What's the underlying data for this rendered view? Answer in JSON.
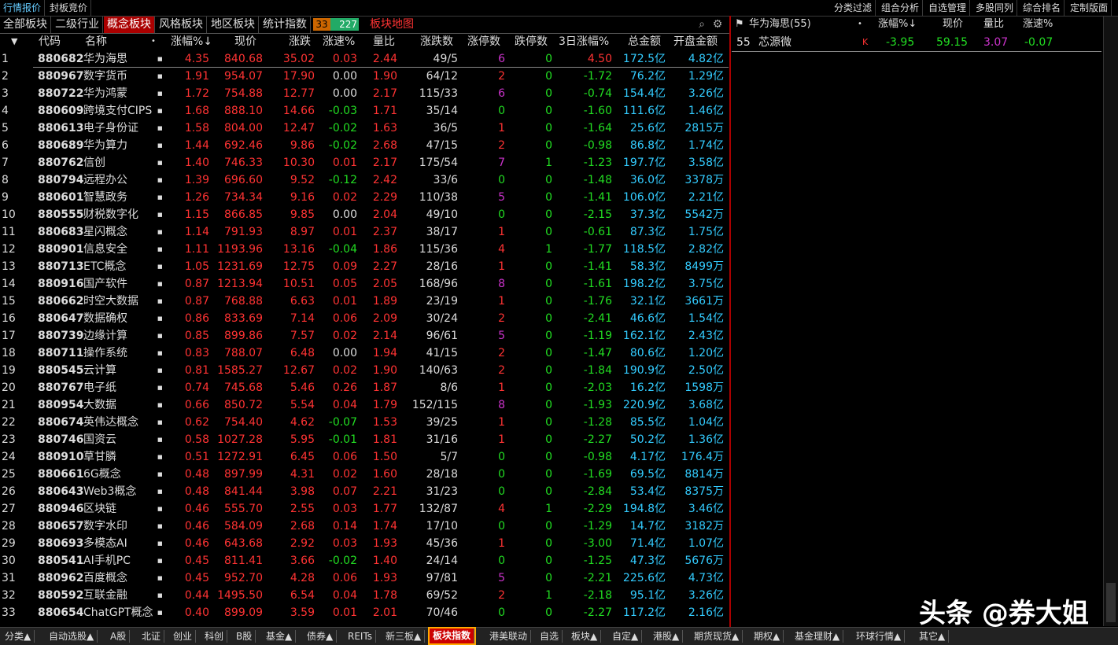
{
  "topbar": {
    "left": [
      "行情报价",
      "封板竞价"
    ],
    "right": [
      "分类过滤",
      "组合分析",
      "自选管理",
      "多股同列",
      "综合排名",
      "定制版面"
    ]
  },
  "cattabs": [
    "全部板块",
    "二级行业",
    "概念板块",
    "风格板块",
    "地区板块",
    "统计指数"
  ],
  "counter": {
    "a": "33",
    "b": "227"
  },
  "map_tab": "板块地图",
  "headers": {
    "idx": "▼",
    "code": "代码",
    "name": "名称",
    "dot": "•",
    "pct": "涨幅%↓",
    "price": "现价",
    "chg": "涨跌",
    "speed": "涨速%",
    "vr": "量比",
    "updown": "涨跌数",
    "zt": "涨停数",
    "dt": "跌停数",
    "d3": "3日涨幅%",
    "amt": "总金额",
    "open": "开盘金额"
  },
  "rows": [
    {
      "i": "1",
      "code": "880682",
      "name": "华为海思",
      "pct": "4.35",
      "price": "840.68",
      "chg": "35.02",
      "speed": "0.03",
      "vr": "2.44",
      "ud": "49/5",
      "zt": "6",
      "dt": "0",
      "d3": "4.50",
      "amt": "172.5亿",
      "open": "4.82亿"
    },
    {
      "i": "2",
      "code": "880967",
      "name": "数字货币",
      "pct": "1.91",
      "price": "954.07",
      "chg": "17.90",
      "speed": "0.00",
      "vr": "1.90",
      "ud": "64/12",
      "zt": "2",
      "dt": "0",
      "d3": "-1.72",
      "amt": "76.2亿",
      "open": "1.29亿"
    },
    {
      "i": "3",
      "code": "880722",
      "name": "华为鸿蒙",
      "pct": "1.72",
      "price": "754.88",
      "chg": "12.77",
      "speed": "0.00",
      "vr": "2.17",
      "ud": "115/33",
      "zt": "6",
      "dt": "0",
      "d3": "-0.74",
      "amt": "154.4亿",
      "open": "3.26亿"
    },
    {
      "i": "4",
      "code": "880609",
      "name": "跨境支付CIPS",
      "pct": "1.68",
      "price": "888.10",
      "chg": "14.66",
      "speed": "-0.03",
      "vr": "1.71",
      "ud": "35/14",
      "zt": "0",
      "dt": "0",
      "d3": "-1.60",
      "amt": "111.6亿",
      "open": "1.46亿"
    },
    {
      "i": "5",
      "code": "880613",
      "name": "电子身份证",
      "pct": "1.58",
      "price": "804.00",
      "chg": "12.47",
      "speed": "-0.02",
      "vr": "1.63",
      "ud": "36/5",
      "zt": "1",
      "dt": "0",
      "d3": "-1.64",
      "amt": "25.6亿",
      "open": "2815万"
    },
    {
      "i": "6",
      "code": "880689",
      "name": "华为算力",
      "pct": "1.44",
      "price": "692.46",
      "chg": "9.86",
      "speed": "-0.02",
      "vr": "2.68",
      "ud": "47/15",
      "zt": "2",
      "dt": "0",
      "d3": "-0.98",
      "amt": "86.8亿",
      "open": "1.74亿"
    },
    {
      "i": "7",
      "code": "880762",
      "name": "信创",
      "pct": "1.40",
      "price": "746.33",
      "chg": "10.30",
      "speed": "0.01",
      "vr": "2.17",
      "ud": "175/54",
      "zt": "7",
      "dt": "1",
      "d3": "-1.23",
      "amt": "197.7亿",
      "open": "3.58亿"
    },
    {
      "i": "8",
      "code": "880794",
      "name": "远程办公",
      "pct": "1.39",
      "price": "696.60",
      "chg": "9.52",
      "speed": "-0.12",
      "vr": "2.42",
      "ud": "33/6",
      "zt": "0",
      "dt": "0",
      "d3": "-1.48",
      "amt": "36.0亿",
      "open": "3378万"
    },
    {
      "i": "9",
      "code": "880601",
      "name": "智慧政务",
      "pct": "1.26",
      "price": "734.34",
      "chg": "9.16",
      "speed": "0.02",
      "vr": "2.29",
      "ud": "110/38",
      "zt": "5",
      "dt": "0",
      "d3": "-1.41",
      "amt": "106.0亿",
      "open": "2.21亿"
    },
    {
      "i": "10",
      "code": "880555",
      "name": "财税数字化",
      "pct": "1.15",
      "price": "866.85",
      "chg": "9.85",
      "speed": "0.00",
      "vr": "2.04",
      "ud": "49/10",
      "zt": "0",
      "dt": "0",
      "d3": "-2.15",
      "amt": "37.3亿",
      "open": "5542万"
    },
    {
      "i": "11",
      "code": "880683",
      "name": "星闪概念",
      "pct": "1.14",
      "price": "791.93",
      "chg": "8.97",
      "speed": "0.01",
      "vr": "2.37",
      "ud": "38/17",
      "zt": "1",
      "dt": "0",
      "d3": "-0.61",
      "amt": "87.3亿",
      "open": "1.75亿"
    },
    {
      "i": "12",
      "code": "880901",
      "name": "信息安全",
      "pct": "1.11",
      "price": "1193.96",
      "chg": "13.16",
      "speed": "-0.04",
      "vr": "1.86",
      "ud": "115/36",
      "zt": "4",
      "dt": "1",
      "d3": "-1.77",
      "amt": "118.5亿",
      "open": "2.82亿"
    },
    {
      "i": "13",
      "code": "880713",
      "name": "ETC概念",
      "pct": "1.05",
      "price": "1231.69",
      "chg": "12.75",
      "speed": "0.09",
      "vr": "2.27",
      "ud": "28/16",
      "zt": "1",
      "dt": "0",
      "d3": "-1.41",
      "amt": "58.3亿",
      "open": "8499万"
    },
    {
      "i": "14",
      "code": "880916",
      "name": "国产软件",
      "pct": "0.87",
      "price": "1213.94",
      "chg": "10.51",
      "speed": "0.05",
      "vr": "2.05",
      "ud": "168/96",
      "zt": "8",
      "dt": "0",
      "d3": "-1.61",
      "amt": "198.2亿",
      "open": "3.75亿"
    },
    {
      "i": "15",
      "code": "880662",
      "name": "时空大数据",
      "pct": "0.87",
      "price": "768.88",
      "chg": "6.63",
      "speed": "0.01",
      "vr": "1.89",
      "ud": "23/19",
      "zt": "1",
      "dt": "0",
      "d3": "-1.76",
      "amt": "32.1亿",
      "open": "3661万"
    },
    {
      "i": "16",
      "code": "880647",
      "name": "数据确权",
      "pct": "0.86",
      "price": "833.69",
      "chg": "7.14",
      "speed": "0.06",
      "vr": "2.09",
      "ud": "30/24",
      "zt": "2",
      "dt": "0",
      "d3": "-2.41",
      "amt": "46.6亿",
      "open": "1.54亿"
    },
    {
      "i": "17",
      "code": "880739",
      "name": "边缘计算",
      "pct": "0.85",
      "price": "899.86",
      "chg": "7.57",
      "speed": "0.02",
      "vr": "2.14",
      "ud": "96/61",
      "zt": "5",
      "dt": "0",
      "d3": "-1.19",
      "amt": "162.1亿",
      "open": "2.43亿"
    },
    {
      "i": "18",
      "code": "880711",
      "name": "操作系统",
      "pct": "0.83",
      "price": "788.07",
      "chg": "6.48",
      "speed": "0.00",
      "vr": "1.94",
      "ud": "41/15",
      "zt": "2",
      "dt": "0",
      "d3": "-1.47",
      "amt": "80.6亿",
      "open": "1.20亿"
    },
    {
      "i": "19",
      "code": "880545",
      "name": "云计算",
      "pct": "0.81",
      "price": "1585.27",
      "chg": "12.67",
      "speed": "0.02",
      "vr": "1.90",
      "ud": "140/63",
      "zt": "2",
      "dt": "0",
      "d3": "-1.84",
      "amt": "190.9亿",
      "open": "2.50亿"
    },
    {
      "i": "20",
      "code": "880767",
      "name": "电子纸",
      "pct": "0.74",
      "price": "745.68",
      "chg": "5.46",
      "speed": "0.26",
      "vr": "1.87",
      "ud": "8/6",
      "zt": "1",
      "dt": "0",
      "d3": "-2.03",
      "amt": "16.2亿",
      "open": "1598万"
    },
    {
      "i": "21",
      "code": "880954",
      "name": "大数据",
      "pct": "0.66",
      "price": "850.72",
      "chg": "5.54",
      "speed": "0.04",
      "vr": "1.79",
      "ud": "152/115",
      "zt": "8",
      "dt": "0",
      "d3": "-1.93",
      "amt": "220.9亿",
      "open": "3.68亿"
    },
    {
      "i": "22",
      "code": "880674",
      "name": "英伟达概念",
      "pct": "0.62",
      "price": "754.40",
      "chg": "4.62",
      "speed": "-0.07",
      "vr": "1.53",
      "ud": "39/25",
      "zt": "1",
      "dt": "0",
      "d3": "-1.28",
      "amt": "85.5亿",
      "open": "1.04亿"
    },
    {
      "i": "23",
      "code": "880746",
      "name": "国资云",
      "pct": "0.58",
      "price": "1027.28",
      "chg": "5.95",
      "speed": "-0.01",
      "vr": "1.81",
      "ud": "31/16",
      "zt": "1",
      "dt": "0",
      "d3": "-2.27",
      "amt": "50.2亿",
      "open": "1.36亿"
    },
    {
      "i": "24",
      "code": "880910",
      "name": "草甘膦",
      "pct": "0.51",
      "price": "1272.91",
      "chg": "6.45",
      "speed": "0.06",
      "vr": "1.50",
      "ud": "5/7",
      "zt": "0",
      "dt": "0",
      "d3": "-0.98",
      "amt": "4.17亿",
      "open": "176.4万"
    },
    {
      "i": "25",
      "code": "880661",
      "name": "6G概念",
      "pct": "0.48",
      "price": "897.99",
      "chg": "4.31",
      "speed": "0.02",
      "vr": "1.60",
      "ud": "28/18",
      "zt": "0",
      "dt": "0",
      "d3": "-1.69",
      "amt": "69.5亿",
      "open": "8814万"
    },
    {
      "i": "26",
      "code": "880643",
      "name": "Web3概念",
      "pct": "0.48",
      "price": "841.44",
      "chg": "3.98",
      "speed": "0.07",
      "vr": "2.21",
      "ud": "31/23",
      "zt": "0",
      "dt": "0",
      "d3": "-2.84",
      "amt": "53.4亿",
      "open": "8375万"
    },
    {
      "i": "27",
      "code": "880946",
      "name": "区块链",
      "pct": "0.46",
      "price": "555.70",
      "chg": "2.55",
      "speed": "0.03",
      "vr": "1.77",
      "ud": "132/87",
      "zt": "4",
      "dt": "1",
      "d3": "-2.29",
      "amt": "194.8亿",
      "open": "3.46亿"
    },
    {
      "i": "28",
      "code": "880657",
      "name": "数字水印",
      "pct": "0.46",
      "price": "584.09",
      "chg": "2.68",
      "speed": "0.14",
      "vr": "1.74",
      "ud": "17/10",
      "zt": "0",
      "dt": "0",
      "d3": "-1.29",
      "amt": "14.7亿",
      "open": "3182万"
    },
    {
      "i": "29",
      "code": "880693",
      "name": "多模态AI",
      "pct": "0.46",
      "price": "643.68",
      "chg": "2.92",
      "speed": "0.03",
      "vr": "1.93",
      "ud": "45/36",
      "zt": "1",
      "dt": "0",
      "d3": "-3.00",
      "amt": "71.4亿",
      "open": "1.07亿"
    },
    {
      "i": "30",
      "code": "880541",
      "name": "AI手机PC",
      "pct": "0.45",
      "price": "811.41",
      "chg": "3.66",
      "speed": "-0.02",
      "vr": "1.40",
      "ud": "24/14",
      "zt": "0",
      "dt": "0",
      "d3": "-1.25",
      "amt": "47.3亿",
      "open": "5676万"
    },
    {
      "i": "31",
      "code": "880962",
      "name": "百度概念",
      "pct": "0.45",
      "price": "952.70",
      "chg": "4.28",
      "speed": "0.06",
      "vr": "1.93",
      "ud": "97/81",
      "zt": "5",
      "dt": "0",
      "d3": "-2.21",
      "amt": "225.6亿",
      "open": "4.73亿"
    },
    {
      "i": "32",
      "code": "880592",
      "name": "互联金融",
      "pct": "0.44",
      "price": "1495.50",
      "chg": "6.54",
      "speed": "0.04",
      "vr": "1.78",
      "ud": "69/52",
      "zt": "2",
      "dt": "1",
      "d3": "-2.18",
      "amt": "95.1亿",
      "open": "3.26亿"
    },
    {
      "i": "33",
      "code": "880654",
      "name": "ChatGPT概念",
      "pct": "0.40",
      "price": "899.09",
      "chg": "3.59",
      "speed": "0.01",
      "vr": "2.01",
      "ud": "70/46",
      "zt": "0",
      "dt": "0",
      "d3": "-2.27",
      "amt": "117.2亿",
      "open": "2.16亿"
    }
  ],
  "right_panel": {
    "title": "华为海思(55)",
    "dot": "•",
    "headers": {
      "pct": "涨幅%↓",
      "price": "现价",
      "vr": "量比",
      "speed": "涨速%"
    },
    "row": {
      "i": "55",
      "name": "芯源微",
      "flag": "K",
      "pct": "-3.95",
      "price": "59.15",
      "vr": "3.07",
      "speed": "-0.07"
    }
  },
  "bottom_tabs": [
    "分类▲",
    "自动选股▲",
    "A股",
    "北证",
    "创业",
    "科创",
    "B股",
    "基金▲",
    "债券▲",
    "REITs",
    "新三板▲",
    "板块指数",
    "港美联动",
    "自选",
    "板块▲",
    "自定▲",
    "港股▲",
    "期货现货▲",
    "期权▲",
    "基金理财▲",
    "环球行情▲",
    "其它▲"
  ],
  "watermark": "头条 @券大姐",
  "colors": {
    "up": "#ff3333",
    "down": "#22dd22",
    "flat": "#dddddd",
    "purple": "#cc33cc",
    "cyan": "#33ccff",
    "active_tab": "#aa0000"
  }
}
